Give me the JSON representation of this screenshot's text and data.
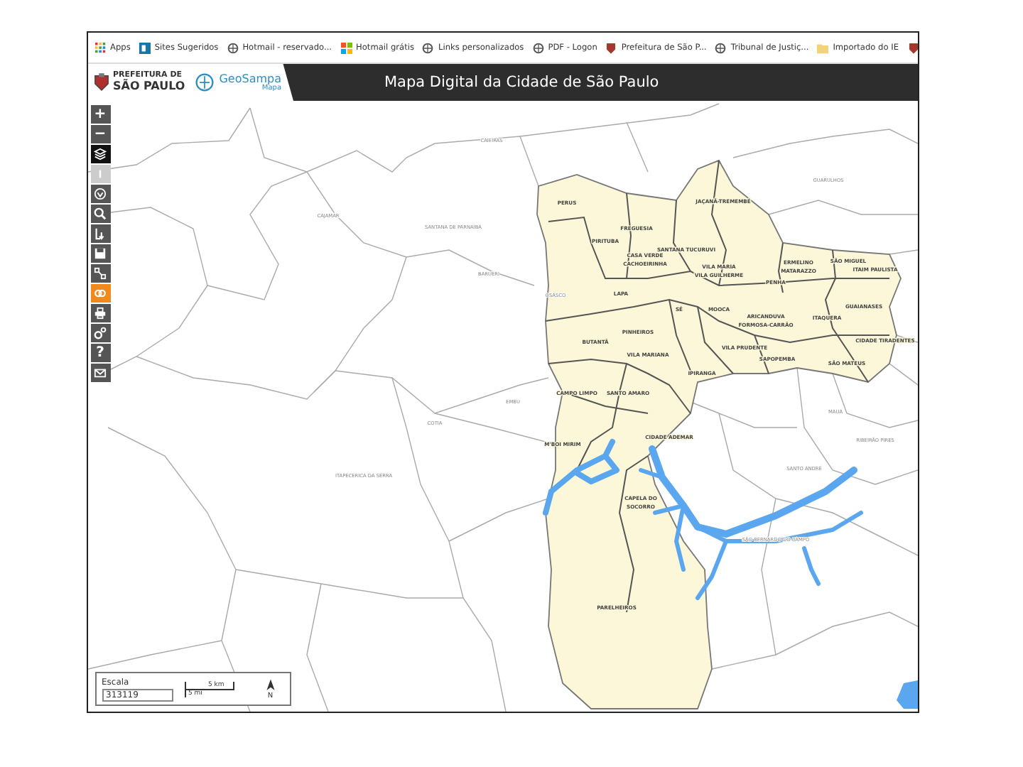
{
  "bookmarks": [
    {
      "kind": "apps",
      "label": "Apps"
    },
    {
      "kind": "page",
      "label": "Sites Sugeridos"
    },
    {
      "kind": "globe",
      "label": "Hotmail - reservado..."
    },
    {
      "kind": "tiles",
      "label": "Hotmail grátis"
    },
    {
      "kind": "globe",
      "label": "Links personalizados"
    },
    {
      "kind": "globe",
      "label": "PDF - Logon"
    },
    {
      "kind": "crest",
      "label": "Prefeitura de São P..."
    },
    {
      "kind": "globe",
      "label": "Tribunal de Justiç..."
    },
    {
      "kind": "folder",
      "label": "Importado do IE"
    },
    {
      "kind": "crest"
    }
  ],
  "header": {
    "org_line1": "PREFEITURA DE",
    "org_line2": "SÃO PAULO",
    "brand": "GeoSampa",
    "brand_sub": "Mapa",
    "title": "Mapa Digital da Cidade de São Paulo"
  },
  "tools": [
    {
      "kind": "plus",
      "label": "+",
      "selected": false,
      "pressed": false,
      "disabled": false
    },
    {
      "kind": "minus",
      "label": "−",
      "selected": false,
      "pressed": false,
      "disabled": false
    },
    {
      "kind": "layers",
      "selected": false,
      "pressed": true,
      "disabled": false
    },
    {
      "kind": "info",
      "selected": false,
      "pressed": false,
      "disabled": true
    },
    {
      "kind": "globe",
      "selected": false,
      "pressed": false,
      "disabled": false
    },
    {
      "kind": "search",
      "selected": false,
      "pressed": false,
      "disabled": false
    },
    {
      "kind": "download",
      "selected": false,
      "pressed": false,
      "disabled": false
    },
    {
      "kind": "save",
      "selected": false,
      "pressed": false,
      "disabled": false
    },
    {
      "kind": "measure",
      "selected": false,
      "pressed": false,
      "disabled": false
    },
    {
      "kind": "link",
      "selected": true,
      "pressed": false,
      "disabled": false
    },
    {
      "kind": "print",
      "selected": false,
      "pressed": false,
      "disabled": false
    },
    {
      "kind": "gears",
      "selected": false,
      "pressed": false,
      "disabled": false
    },
    {
      "kind": "help",
      "label": "?",
      "selected": false,
      "pressed": false,
      "disabled": false
    },
    {
      "kind": "mail",
      "selected": false,
      "pressed": false,
      "disabled": false
    }
  ],
  "map": {
    "labels": [
      {
        "kind": "district",
        "text": "PERUS"
      },
      {
        "kind": "district",
        "text": "FREGUESIA"
      },
      {
        "kind": "district",
        "text": "PIRITUBA"
      },
      {
        "kind": "district",
        "text": "SANTANA TUCURUVI"
      },
      {
        "kind": "district",
        "text": "CASA VERDE"
      },
      {
        "kind": "district",
        "text": "CACHOEIRINHA"
      },
      {
        "kind": "district",
        "text": "JAÇANÃ-TREMEMBÉ"
      },
      {
        "kind": "district",
        "text": "VILA MARIA"
      },
      {
        "kind": "district",
        "text": "VILA GUILHERME"
      },
      {
        "kind": "district",
        "text": "ERMELINO"
      },
      {
        "kind": "district",
        "text": "MATARAZZO"
      },
      {
        "kind": "district",
        "text": "SÃO MIGUEL"
      },
      {
        "kind": "district",
        "text": "ITAIM PAULISTA"
      },
      {
        "kind": "district",
        "text": "PENHA"
      },
      {
        "kind": "district",
        "text": "LAPA"
      },
      {
        "kind": "district",
        "text": "SÉ"
      },
      {
        "kind": "district",
        "text": "MOOCA"
      },
      {
        "kind": "district",
        "text": "ARICANDUVA"
      },
      {
        "kind": "district",
        "text": "FORMOSA-CARRÃO"
      },
      {
        "kind": "district",
        "text": "ITAQUERA"
      },
      {
        "kind": "district",
        "text": "GUAIANASES"
      },
      {
        "kind": "district",
        "text": "CIDADE TIRADENTES"
      },
      {
        "kind": "district",
        "text": "PINHEIROS"
      },
      {
        "kind": "district",
        "text": "BUTANTÃ"
      },
      {
        "kind": "district",
        "text": "VILA MARIANA"
      },
      {
        "kind": "district",
        "text": "VILA PRUDENTE"
      },
      {
        "kind": "district",
        "text": "SAPOPEMBA"
      },
      {
        "kind": "district",
        "text": "SÃO MATEUS"
      },
      {
        "kind": "district",
        "text": "IPIRANGA"
      },
      {
        "kind": "district",
        "text": "CAMPO LIMPO"
      },
      {
        "kind": "district",
        "text": "SANTO AMARO"
      },
      {
        "kind": "district",
        "text": "CIDADE ADEMAR"
      },
      {
        "kind": "district",
        "text": "M'BOI MIRIM"
      },
      {
        "kind": "district",
        "text": "CAPELA DO"
      },
      {
        "kind": "district",
        "text": "SOCORRO"
      },
      {
        "kind": "district",
        "text": "PARELHEIROS"
      },
      {
        "kind": "municipality",
        "text": "CAIEIRAS"
      },
      {
        "kind": "municipality",
        "text": "GUARULHOS"
      },
      {
        "kind": "municipality",
        "text": "CAJAMAR"
      },
      {
        "kind": "municipality",
        "text": "SANTANA DE PARNAÍBA"
      },
      {
        "kind": "municipality",
        "text": "BARUERI"
      },
      {
        "kind": "municipality",
        "text": "OSASCO"
      },
      {
        "kind": "municipality",
        "text": "COTIA"
      },
      {
        "kind": "municipality",
        "text": "EMBU"
      },
      {
        "kind": "municipality",
        "text": "ITAPECERICA DA SERRA"
      },
      {
        "kind": "municipality",
        "text": "MAUÁ"
      },
      {
        "kind": "municipality",
        "text": "SANTO ANDRÉ"
      },
      {
        "kind": "municipality",
        "text": "RIBEIRÃO PIRES"
      },
      {
        "kind": "municipality",
        "text": "SÃO BERNARDO DO CAMPO"
      }
    ]
  },
  "scale": {
    "label": "Escala",
    "value": "313119",
    "bar_top": "5 km",
    "bar_bottom": "5 mi",
    "north": "N"
  }
}
